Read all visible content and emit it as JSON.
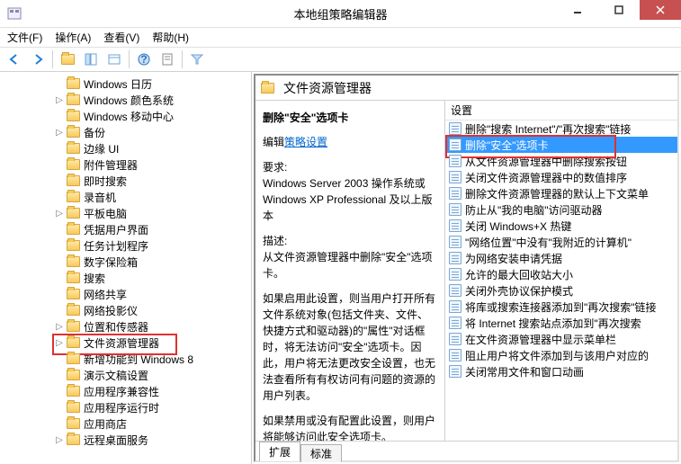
{
  "window": {
    "title": "本地组策略编辑器"
  },
  "menu": {
    "file": "文件(F)",
    "action": "操作(A)",
    "view": "查看(V)",
    "help": "帮助(H)"
  },
  "tree": {
    "items": [
      {
        "label": "Windows 日历",
        "exp": ""
      },
      {
        "label": "Windows 颜色系统",
        "exp": "▷"
      },
      {
        "label": "Windows 移动中心",
        "exp": ""
      },
      {
        "label": "备份",
        "exp": "▷"
      },
      {
        "label": "边缘 UI",
        "exp": ""
      },
      {
        "label": "附件管理器",
        "exp": ""
      },
      {
        "label": "即时搜索",
        "exp": ""
      },
      {
        "label": "录音机",
        "exp": ""
      },
      {
        "label": "平板电脑",
        "exp": "▷"
      },
      {
        "label": "凭据用户界面",
        "exp": ""
      },
      {
        "label": "任务计划程序",
        "exp": ""
      },
      {
        "label": "数字保险箱",
        "exp": ""
      },
      {
        "label": "搜索",
        "exp": ""
      },
      {
        "label": "网络共享",
        "exp": ""
      },
      {
        "label": "网络投影仪",
        "exp": ""
      },
      {
        "label": "位置和传感器",
        "exp": "▷"
      },
      {
        "label": "文件资源管理器",
        "exp": "▷",
        "hl": true
      },
      {
        "label": "新增功能到 Windows 8",
        "exp": ""
      },
      {
        "label": "演示文稿设置",
        "exp": ""
      },
      {
        "label": "应用程序兼容性",
        "exp": ""
      },
      {
        "label": "应用程序运行时",
        "exp": ""
      },
      {
        "label": "应用商店",
        "exp": ""
      },
      {
        "label": "远程桌面服务",
        "exp": "▷"
      }
    ]
  },
  "content": {
    "header": "文件资源管理器",
    "detail": {
      "title": "删除\"安全\"选项卡",
      "edit_label": "编辑",
      "edit_link": "策略设置",
      "req_label": "要求:",
      "req_text": "Windows Server 2003 操作系统或 Windows XP Professional 及以上版本",
      "desc_label": "描述:",
      "desc1": "从文件资源管理器中删除\"安全\"选项卡。",
      "desc2": "如果启用此设置，则当用户打开所有文件系统对象(包括文件夹、文件、快捷方式和驱动器)的\"属性\"对话框时，将无法访问\"安全\"选项卡。因此，用户将无法更改安全设置，也无法查看所有有权访问有问题的资源的用户列表。",
      "desc3": "如果禁用或没有配置此设置，则用户将能够访问此安全选项卡。"
    },
    "list_header": "设置",
    "settings": [
      {
        "label": "删除\"搜索 Internet\"/\"再次搜索\"链接"
      },
      {
        "label": "删除\"安全\"选项卡",
        "sel": true,
        "hl": true
      },
      {
        "label": "从文件资源管理器中删除搜索按钮"
      },
      {
        "label": "关闭文件资源管理器中的数值排序"
      },
      {
        "label": "删除文件资源管理器的默认上下文菜单"
      },
      {
        "label": "防止从\"我的电脑\"访问驱动器"
      },
      {
        "label": "关闭 Windows+X 热键"
      },
      {
        "label": "\"网络位置\"中没有\"我附近的计算机\""
      },
      {
        "label": "为网络安装申请凭据"
      },
      {
        "label": "允许的最大回收站大小"
      },
      {
        "label": "关闭外壳协议保护模式"
      },
      {
        "label": "将库或搜索连接器添加到\"再次搜索\"链接"
      },
      {
        "label": "将 Internet 搜索站点添加到\"再次搜索"
      },
      {
        "label": "在文件资源管理器中显示菜单栏"
      },
      {
        "label": "阻止用户将文件添加到与该用户对应的"
      },
      {
        "label": "关闭常用文件和窗口动画"
      }
    ],
    "tabs": {
      "extended": "扩展",
      "standard": "标准"
    }
  }
}
